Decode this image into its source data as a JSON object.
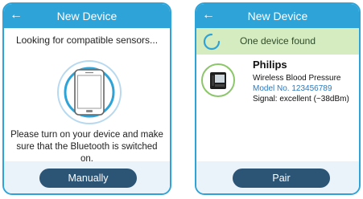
{
  "colors": {
    "header": "#2ea3d8",
    "button": "#2b5475",
    "banner": "#d5ebc0",
    "model_link": "#2a7bc0"
  },
  "left_screen": {
    "back_icon": "arrow-left",
    "title": "New Device",
    "status": "Looking for compatible sensors...",
    "instructions": "Please turn on your device and make sure that the Bluetooth is switched on.",
    "manual_button": "Manually"
  },
  "right_screen": {
    "back_icon": "arrow-left",
    "title": "New Device",
    "found_text": "One device found",
    "device": {
      "brand": "Philips",
      "product": "Wireless Blood Pressure",
      "model": "Model No. 123456789",
      "signal": "Signal: excellent (~38dBm)"
    },
    "pair_button": "Pair"
  }
}
